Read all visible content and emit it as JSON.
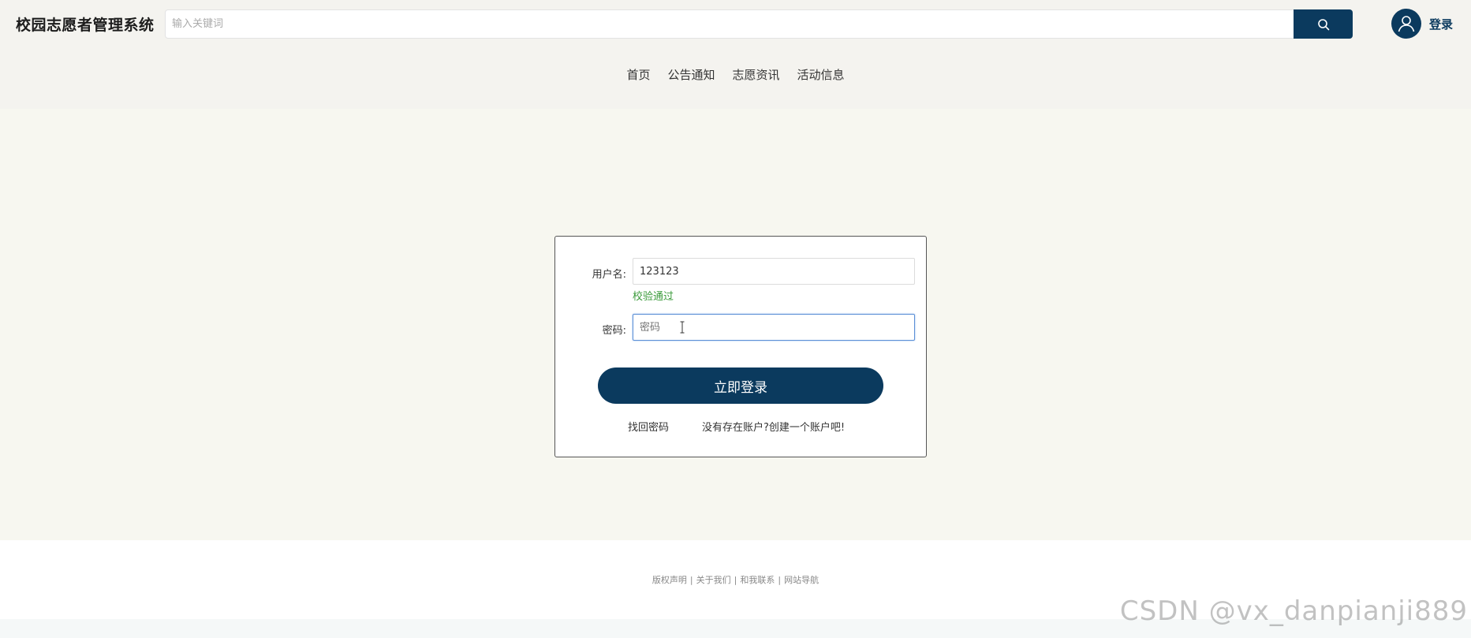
{
  "header": {
    "site_title": "校园志愿者管理系统",
    "search_placeholder": "输入关键词",
    "login_label": "登录"
  },
  "nav": {
    "items": [
      "首页",
      "公告通知",
      "志愿资讯",
      "活动信息"
    ]
  },
  "login_form": {
    "username_label": "用户名:",
    "username_value": "123123",
    "username_hint": "校验通过",
    "password_label": "密码:",
    "password_placeholder": "密码",
    "submit_label": "立即登录",
    "forgot_label": "找回密码",
    "register_label": "没有存在账户?创建一个账户吧!"
  },
  "footer": {
    "links": [
      "版权声明",
      "关于我们",
      "和我联系",
      "网站导航"
    ],
    "separator": "|"
  },
  "watermark": "CSDN @vx_danpianji889",
  "colors": {
    "brand": "#0b3a5e",
    "header_bg": "#f4f3ef",
    "main_bg": "#f7f7f0",
    "success": "#3a9a3a"
  }
}
